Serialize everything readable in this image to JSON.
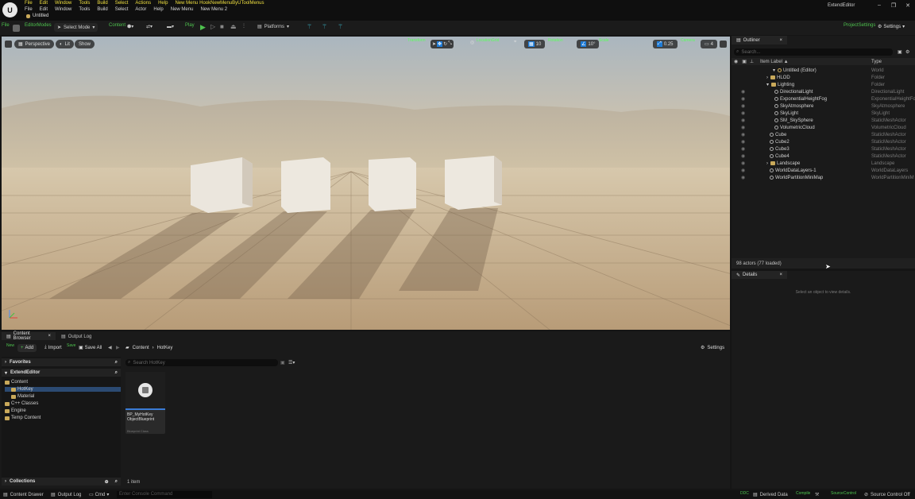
{
  "titlebar": {
    "menu_top": [
      "File",
      "Edit",
      "Window",
      "Tools",
      "Build",
      "Select",
      "Actions",
      "Help",
      "New Menu",
      "HookNewMenuByUToolMenus"
    ],
    "menu_bottom": [
      "File",
      "Edit",
      "Window",
      "Tools",
      "Build",
      "Select",
      "Actor",
      "Help",
      "New Menu",
      "New Menu 2"
    ],
    "tab_title": "Untitled",
    "window_title": "ExtendEditor",
    "win_minimize": "–",
    "win_restore": "❐",
    "win_close": "✕"
  },
  "toolbar": {
    "file": "File",
    "editor_modes": "EditorModes",
    "select_mode": "Select Mode",
    "content": "Content",
    "play": "Play",
    "platforms": "Platforms",
    "project_settings": "ProjectSettings",
    "settings": "Settings"
  },
  "viewport": {
    "perspective": "Perspective",
    "lit": "Lit",
    "show": "Show",
    "transform_label": "Transform",
    "location_label": "LocationGrid",
    "grid_value": "10",
    "rotation_label": "Rotation",
    "rotation_value": "10°",
    "scale_label": "Scale",
    "scale_value": "0.25",
    "camera_label": "Camera",
    "camera_value": "4"
  },
  "outliner": {
    "tab": "Outliner",
    "search_placeholder": "Search...",
    "col_label": "Item Label ▲",
    "col_type": "Type",
    "items": [
      {
        "label": "Untitled (Editor)",
        "type": "World",
        "kind": "world"
      },
      {
        "label": "HLOD",
        "type": "Folder",
        "kind": "folder"
      },
      {
        "label": "Lighting",
        "type": "Folder",
        "kind": "folder"
      },
      {
        "label": "DirectionalLight",
        "type": "DirectionalLight",
        "kind": "actor"
      },
      {
        "label": "ExponentialHeightFog",
        "type": "ExponentialHeightFog",
        "kind": "actor"
      },
      {
        "label": "SkyAtmosphere",
        "type": "SkyAtmosphere",
        "kind": "actor"
      },
      {
        "label": "SkyLight",
        "type": "SkyLight",
        "kind": "actor"
      },
      {
        "label": "SM_SkySphere",
        "type": "StaticMeshActor",
        "kind": "actor"
      },
      {
        "label": "VolumetricCloud",
        "type": "VolumetricCloud",
        "kind": "actor"
      },
      {
        "label": "Cube",
        "type": "StaticMeshActor",
        "kind": "actor"
      },
      {
        "label": "Cube2",
        "type": "StaticMeshActor",
        "kind": "actor"
      },
      {
        "label": "Cube3",
        "type": "StaticMeshActor",
        "kind": "actor"
      },
      {
        "label": "Cube4",
        "type": "StaticMeshActor",
        "kind": "actor"
      },
      {
        "label": "Landscape",
        "type": "Landscape",
        "kind": "folder"
      },
      {
        "label": "WorldDataLayers-1",
        "type": "WorldDataLayers",
        "kind": "actor"
      },
      {
        "label": "WorldPartitionMiniMap",
        "type": "WorldPartitionMiniM",
        "kind": "actor"
      }
    ],
    "footer": "98 actors (77 loaded)"
  },
  "details": {
    "tab": "Details",
    "empty": "Select an object to view details."
  },
  "content_browser": {
    "tab": "Content Browser",
    "output_tab": "Output Log",
    "new_label": "New",
    "add": "Add",
    "import": "Import",
    "save_label": "Save",
    "save_all": "Save All",
    "path": [
      "Content",
      "HotKey"
    ],
    "settings": "Settings",
    "favorites": "Favorites",
    "project": "ExtendEditor",
    "tree": [
      "Content",
      "HotKey",
      "Material",
      "C++ Classes",
      "Engine",
      "Temp Content"
    ],
    "search_placeholder": "Search HotKey",
    "asset_name": "BP_MyHotKey ObjectBlueprint",
    "asset_type": "Blueprint Class",
    "item_count": "1 item",
    "collections": "Collections"
  },
  "statusbar": {
    "content_drawer": "Content Drawer",
    "output_log": "Output Log",
    "cmd": "Cmd",
    "console_placeholder": "Enter Console Command",
    "ddc": "DDC",
    "derived_data": "Derived Data",
    "compile": "Compile",
    "source_control_label": "SourceControl",
    "source_control": "Source Control Off"
  }
}
